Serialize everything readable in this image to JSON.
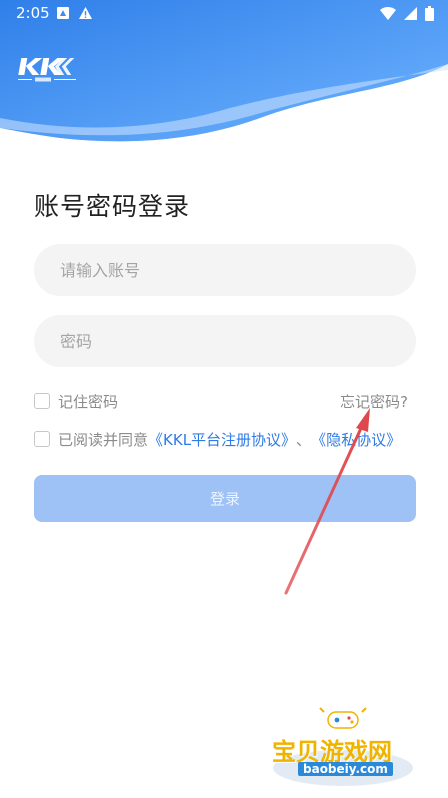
{
  "status_bar": {
    "time": "2:05",
    "left_icons": [
      "notification-app-icon",
      "warning-icon"
    ],
    "right_icons": [
      "wifi-icon",
      "cellular-signal-icon",
      "battery-icon"
    ]
  },
  "header": {
    "logo_text": "KKL",
    "brand_color": "#3d8cf0"
  },
  "login": {
    "title": "账号密码登录",
    "account_placeholder": "请输入账号",
    "password_placeholder": "密码",
    "remember_label": "记住密码",
    "forgot_label": "忘记密码?",
    "agree_prefix": "已阅读并同意",
    "terms_link": "《KKL平台注册协议》",
    "separator": "、",
    "privacy_link": "《隐私协议》",
    "submit_label": "登录"
  },
  "watermark": {
    "text": "宝贝游戏网",
    "domain": "baobeiy.com"
  },
  "colors": {
    "accent": "#2f7be6",
    "button_disabled": "#9ec2f5",
    "field_bg": "#f4f4f5",
    "annotation_arrow": "#e0474c"
  }
}
